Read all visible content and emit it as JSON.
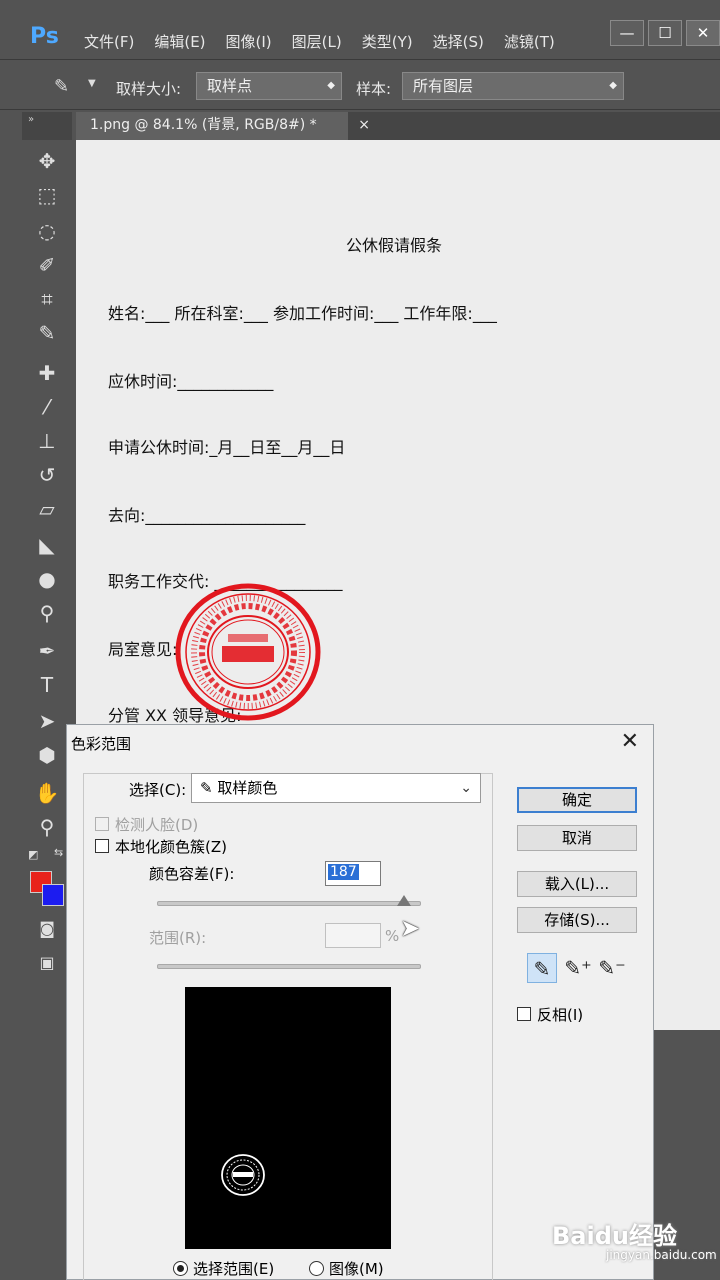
{
  "app": {
    "logo": "Ps",
    "theme_color": "#4ea9ff"
  },
  "menu": [
    "文件(F)",
    "编辑(E)",
    "图像(I)",
    "图层(L)",
    "类型(Y)",
    "选择(S)",
    "滤镜(T)"
  ],
  "window_buttons": {
    "minimize": "—",
    "maximize": "☐",
    "close": "✕"
  },
  "options": {
    "sample_size_label": "取样大小:",
    "sample_size_value": "取样点",
    "sample_label": "样本:",
    "sample_value": "所有图层"
  },
  "tab": {
    "name": "1.png @ 84.1% (背景, RGB/8#) *",
    "close": "×"
  },
  "toolbar_head": "»",
  "document": {
    "title": "公休假请假条",
    "lines": [
      "姓名:___   所在科室:___   参加工作时间:___   工作年限:___",
      "应休时间:____________",
      "申请公休时间:_月__日至__月__日",
      "去向:____________________",
      "职务工作交代:     ________________",
      "局室意见:",
      "分管 XX 领导意见:"
    ],
    "stamp": {
      "outer_text": "DAKUE WEN YI QING NIAN DEI TAN JING DI SAI ZO · TAI BEI",
      "inner_ring": "台北大学文艺青年组委会",
      "center": "台北大学组委",
      "color": "#e2171e"
    }
  },
  "colors": {
    "foreground": "#e8231b",
    "background": "#1c1cf0"
  },
  "dialog": {
    "title": "色彩范围",
    "close": "✕",
    "select_label": "选择(C):",
    "select_value": "取样颜色",
    "detect_faces": "检测人脸(D)",
    "localized_clusters": "本地化颜色簇(Z)",
    "fuzziness_label": "颜色容差(F):",
    "fuzziness_value": "187",
    "fuzziness_fraction": 0.92,
    "range_label": "范围(R):",
    "range_unit": "%",
    "radio_selection": "选择范围(E)",
    "radio_image": "图像(M)",
    "ok": "确定",
    "cancel": "取消",
    "load": "载入(L)...",
    "save": "存储(S)...",
    "invert": "反相(I)"
  },
  "watermark": {
    "main": "Baidu经验",
    "sub": "jingyan.baidu.com"
  }
}
